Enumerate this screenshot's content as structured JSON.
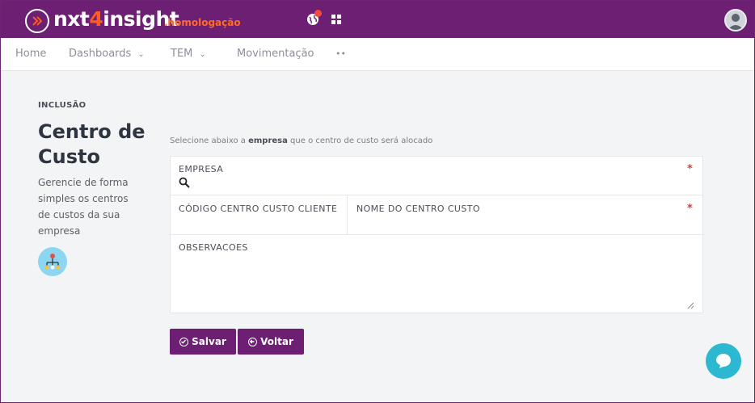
{
  "header": {
    "brand_part1": "nxt",
    "brand_part2": "4",
    "brand_part3": "insight",
    "environment": ".homologação",
    "icons": [
      "logo-chevrons-icon",
      "globe-icon",
      "apps-grid-icon",
      "user-avatar-icon"
    ],
    "colors": {
      "bar": "#6c1f73",
      "accent": "#ff5a1f",
      "notification": "#f24b3a"
    }
  },
  "nav": {
    "items": [
      {
        "label": "Home",
        "has_dropdown": false
      },
      {
        "label": "Dashboards",
        "has_dropdown": true
      },
      {
        "label": "TEM",
        "has_dropdown": true
      },
      {
        "label": "Movimentação",
        "has_dropdown": false
      },
      {
        "label": "••",
        "has_dropdown": false
      }
    ]
  },
  "page": {
    "section": "INCLUSÃO",
    "title": "Centro de Custo",
    "description": "Gerencie de forma simples os centros de custos da sua empresa",
    "icon": "org-tree-icon"
  },
  "form": {
    "hint_prefix": "Selecione abaixo a ",
    "hint_bold": "empresa",
    "hint_suffix": " que o centro de custo será alocado",
    "empresa_label": "EMPRESA",
    "empresa_value": "",
    "codigo_label": "CÓDIGO CENTRO CUSTO CLIENTE",
    "codigo_value": "",
    "nome_label": "NOME DO CENTRO CUSTO",
    "nome_value": "",
    "observacoes_label": "OBSERVACOES",
    "observacoes_value": "",
    "required_mark": "*"
  },
  "actions": {
    "save_label": "Salvar",
    "back_label": "Voltar"
  }
}
